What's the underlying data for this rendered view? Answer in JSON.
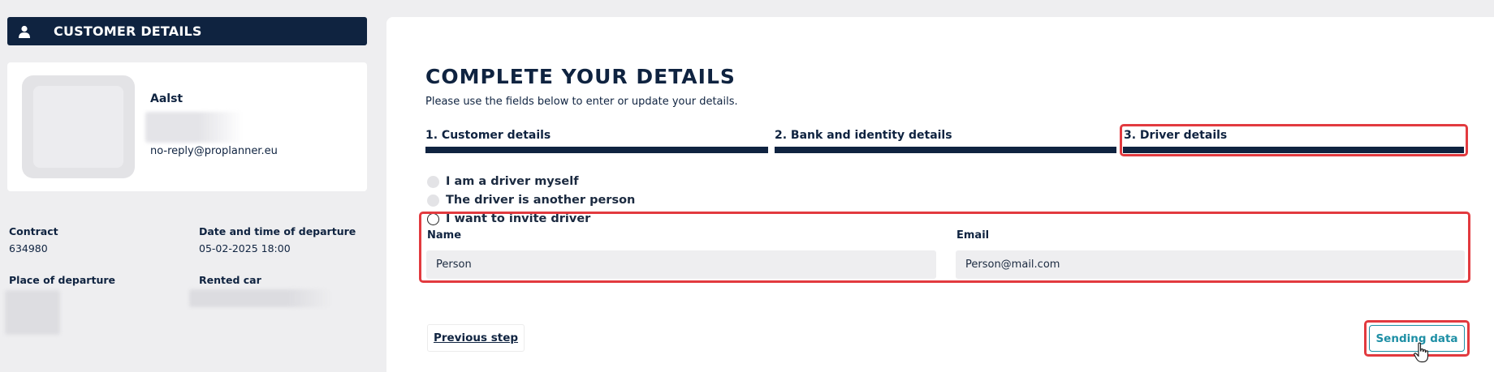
{
  "sidebar": {
    "header_title": "CUSTOMER DETAILS",
    "header_icon": "user-icon",
    "profile": {
      "name": "Aalst",
      "email": "no-reply@proplanner.eu"
    },
    "info": {
      "contract_label": "Contract",
      "contract_value": "634980",
      "departure_datetime_label": "Date and time of departure",
      "departure_datetime_value": "05-02-2025 18:00",
      "departure_place_label": "Place of departure",
      "rented_car_label": "Rented car"
    }
  },
  "main": {
    "title": "COMPLETE YOUR DETAILS",
    "subtitle": "Please use the fields below to enter or update your details.",
    "steps": [
      {
        "label": "1. Customer details"
      },
      {
        "label": "2. Bank and identity details"
      },
      {
        "label": "3. Driver details"
      }
    ],
    "driver_options": [
      {
        "label": "I am a driver myself",
        "state": "disabled"
      },
      {
        "label": "The driver is another person",
        "state": "disabled"
      },
      {
        "label": "I want to invite driver",
        "state": "enabled"
      }
    ],
    "form": {
      "name_label": "Name",
      "name_value": "Person",
      "email_label": "Email",
      "email_value": "Person@mail.com"
    },
    "buttons": {
      "previous": "Previous step",
      "send": "Sending data"
    }
  },
  "colors": {
    "navy": "#0f2340",
    "highlight": "#e23a3f",
    "teal": "#1e8fa5",
    "background": "#eeeef0"
  }
}
